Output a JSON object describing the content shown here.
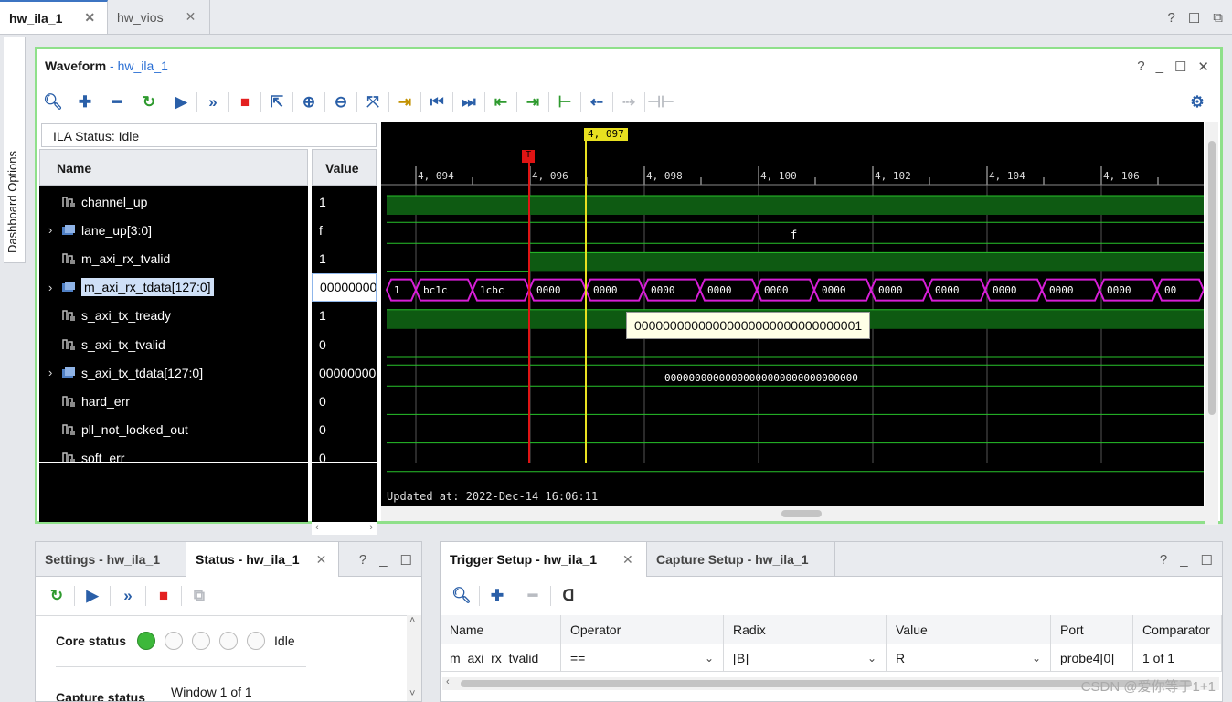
{
  "top_tabs": [
    {
      "label": "hw_ila_1"
    },
    {
      "label": "hw_vios"
    }
  ],
  "top_controls": [
    "?",
    "☐",
    "⧉"
  ],
  "side_tab": {
    "label": "Dashboard Options"
  },
  "waveform": {
    "title": "Waveform",
    "title_sep": " - ",
    "title_sub": "hw_ila_1",
    "controls": [
      "?",
      "_",
      "☐",
      "✕"
    ],
    "ila_status": "ILA Status:  Idle",
    "col_name": "Name",
    "col_value": "Value",
    "signals": [
      {
        "name": "channel_up",
        "value": "1",
        "expandable": false,
        "bus": false
      },
      {
        "name": "lane_up[3:0]",
        "value": "f",
        "expandable": true,
        "bus": true
      },
      {
        "name": "m_axi_rx_tvalid",
        "value": "1",
        "expandable": false,
        "bus": false
      },
      {
        "name": "m_axi_rx_tdata[127:0]",
        "value": "00000000",
        "expandable": true,
        "bus": true,
        "selected": true
      },
      {
        "name": "s_axi_tx_tready",
        "value": "1",
        "expandable": false,
        "bus": false
      },
      {
        "name": "s_axi_tx_tvalid",
        "value": "0",
        "expandable": false,
        "bus": false
      },
      {
        "name": "s_axi_tx_tdata[127:0]",
        "value": "00000000",
        "expandable": true,
        "bus": true
      },
      {
        "name": "hard_err",
        "value": "0",
        "expandable": false,
        "bus": false
      },
      {
        "name": "pll_not_locked_out",
        "value": "0",
        "expandable": false,
        "bus": false
      },
      {
        "name": "soft_err",
        "value": "0",
        "expandable": false,
        "bus": false
      }
    ],
    "ruler_ticks": [
      "4, 094",
      "4, 096",
      "4, 098",
      "4, 100",
      "4, 102",
      "4, 104",
      "4, 106"
    ],
    "cursor_label": "4, 097",
    "trigger_marker": "T",
    "lane_up_label": "f",
    "rx_tdata_segments": [
      "1",
      "bc1c",
      "1cbc",
      "0000",
      "0000",
      "0000",
      "0000",
      "0000",
      "0000",
      "0000",
      "0000",
      "0000",
      "0000",
      "0000",
      "00"
    ],
    "tx_tdata_label": "00000000000000000000000000000000",
    "tooltip": "00000000000000000000000000000001",
    "updated_at": "Updated at: 2022-Dec-14 16:06:11",
    "colors": {
      "high": "#0e5a12",
      "high_line": "#27c22a",
      "bus": "#d61ed6",
      "trigger": "#e01414",
      "cursor": "#e8e020"
    }
  },
  "status_panel": {
    "tab_settings": "Settings - hw_ila_1",
    "tab_status": "Status - hw_ila_1",
    "controls": [
      "?",
      "_",
      "☐"
    ],
    "core_status_label": "Core status",
    "core_status_value": "Idle",
    "capture_status_label": "Capture status",
    "capture_status_value": "Window 1 of 1"
  },
  "trigger_panel": {
    "tab_trigger": "Trigger Setup - hw_ila_1",
    "tab_capture": "Capture Setup - hw_ila_1",
    "controls": [
      "?",
      "_",
      "☐"
    ],
    "headers": [
      "Name",
      "Operator",
      "Radix",
      "Value",
      "Port",
      "Comparator"
    ],
    "row": [
      "m_axi_rx_tvalid",
      "==",
      "[B]",
      "R",
      "probe4[0]",
      "1 of 1"
    ]
  },
  "watermark": "CSDN @爱你等于1+1"
}
